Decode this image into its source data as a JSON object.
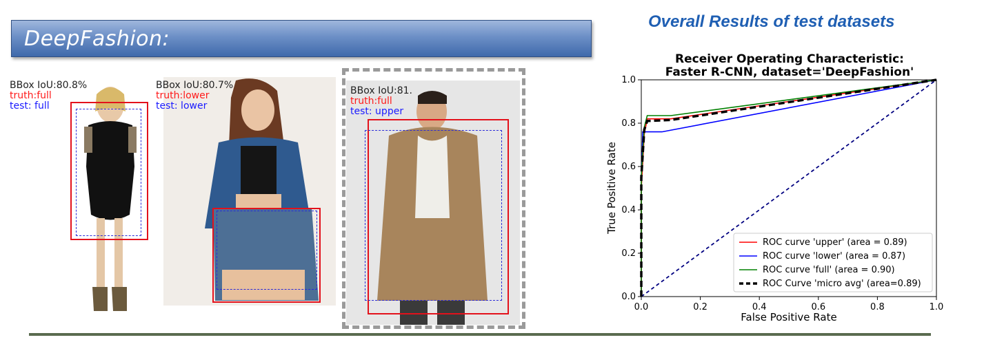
{
  "header": {
    "banner_title": "DeepFashion:",
    "right_heading": "Overall Results of  test datasets"
  },
  "samples": [
    {
      "iou": "BBox IoU:80.8%",
      "truth": "truth:full",
      "test": "test: full"
    },
    {
      "iou": "BBox IoU:80.7%",
      "truth": "truth:lower",
      "test": "test: lower"
    },
    {
      "iou": "BBox IoU:81.",
      "truth": "truth:full",
      "test": "test: upper"
    }
  ],
  "colors": {
    "upper": "#ff0000",
    "lower": "#0000ff",
    "full": "#008000",
    "micro": "#000000",
    "chance": "#000080",
    "truth_text": "#ff1a1a",
    "test_text": "#1a1aff"
  },
  "chart_data": {
    "type": "line",
    "title": [
      "Receiver Operating Characteristic:",
      "Faster R-CNN, dataset='DeepFashion'"
    ],
    "xlabel": "False Positive Rate",
    "ylabel": "True Positive Rate",
    "xlim": [
      0.0,
      1.0
    ],
    "ylim": [
      0.0,
      1.0
    ],
    "xticks": [
      "0.0",
      "0.2",
      "0.4",
      "0.6",
      "0.8",
      "1.0"
    ],
    "yticks": [
      "0.0",
      "0.2",
      "0.4",
      "0.6",
      "0.8",
      "1.0"
    ],
    "grid": false,
    "legend_position": "lower-right",
    "series": [
      {
        "name": "ROC curve 'upper' (area = 0.89)",
        "key": "upper",
        "style": "solid",
        "x": [
          0.0,
          0.0,
          0.01,
          0.02,
          0.1,
          1.0
        ],
        "y": [
          0.0,
          0.5,
          0.75,
          0.82,
          0.82,
          1.0
        ]
      },
      {
        "name": "ROC curve 'lower' (area = 0.87)",
        "key": "lower",
        "style": "solid",
        "x": [
          0.0,
          0.0,
          0.005,
          0.07,
          1.0
        ],
        "y": [
          0.0,
          0.5,
          0.76,
          0.76,
          1.0
        ]
      },
      {
        "name": "ROC curve 'full' (area = 0.90)",
        "key": "full",
        "style": "solid",
        "x": [
          0.0,
          0.0,
          0.01,
          0.02,
          0.1,
          1.0
        ],
        "y": [
          0.0,
          0.55,
          0.78,
          0.835,
          0.835,
          1.0
        ]
      },
      {
        "name": "ROC Curve 'micro avg' (area=0.89)",
        "key": "micro",
        "style": "dashed",
        "x": [
          0.0,
          0.0,
          0.01,
          0.02,
          0.1,
          1.0
        ],
        "y": [
          0.0,
          0.55,
          0.77,
          0.81,
          0.815,
          1.0
        ]
      },
      {
        "name": "",
        "key": "chance",
        "style": "dashed",
        "x": [
          0.0,
          1.0
        ],
        "y": [
          0.0,
          1.0
        ]
      }
    ]
  }
}
